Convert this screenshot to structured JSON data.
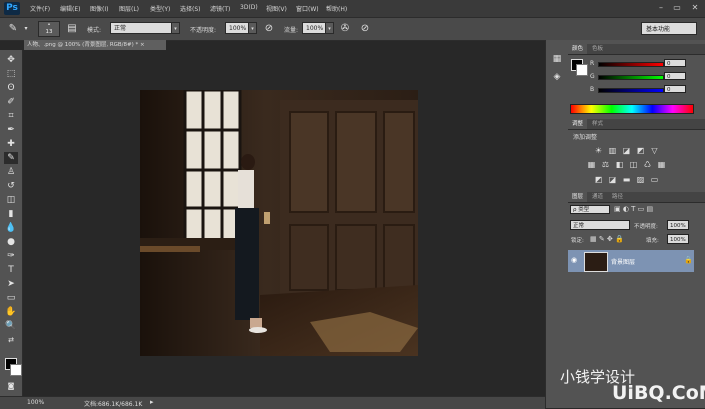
{
  "app": {
    "logo": "Ps"
  },
  "menu": [
    "文件(F)",
    "编辑(E)",
    "图像(I)",
    "图层(L)",
    "类型(Y)",
    "选择(S)",
    "滤镜(T)",
    "3D(D)",
    "视图(V)",
    "窗口(W)",
    "帮助(H)"
  ],
  "window_controls": {
    "minimize": "–",
    "restore": "▭",
    "close": "✕"
  },
  "options_bar": {
    "brush_size": "13",
    "mode_label": "模式:",
    "mode_value": "正常",
    "opacity_label": "不透明度:",
    "opacity_value": "100%",
    "flow_label": "流量:",
    "flow_value": "100%",
    "workspace": "基本功能"
  },
  "document_tab": "人物、.png @ 100% (背景图层, RGB/8#) * ×",
  "status_bar": {
    "zoom": "100%",
    "doc_size": "文档:686.1K/686.1K"
  },
  "color_panel": {
    "tabs": [
      "颜色",
      "色板"
    ],
    "channels": [
      {
        "label": "R",
        "value": "0",
        "color": "#e02020"
      },
      {
        "label": "G",
        "value": "0",
        "color": "#20c020"
      },
      {
        "label": "B",
        "value": "0",
        "color": "#2040e0"
      }
    ]
  },
  "adjust_panel": {
    "tabs": [
      "调整",
      "样式"
    ],
    "title": "添加调整",
    "row1": [
      "☀",
      "▥",
      "◪",
      "◩",
      "▽"
    ],
    "row2": [
      "▦",
      "⚖",
      "◧",
      "◫",
      "♺",
      "▦"
    ],
    "row3": [
      "◩",
      "◪",
      "▬",
      "▨",
      "▭"
    ]
  },
  "layers_panel": {
    "tabs": [
      "图层",
      "通道",
      "路径"
    ],
    "kind_label": "ρ 类型",
    "blend_mode": "正常",
    "opacity_label": "不透明度:",
    "opacity_value": "100%",
    "lock_label": "锁定:",
    "fill_label": "填充:",
    "fill_value": "100%",
    "layers": [
      {
        "name": "背景图层",
        "visible_icon": "👁"
      }
    ],
    "bottom_icons": [
      "⊖",
      "fx",
      "◐",
      "▭",
      "▤",
      "▣",
      "🗑"
    ]
  },
  "watermark": {
    "line1": "小钱学设计",
    "line2": "UiBQ.CoM"
  },
  "colors": {
    "ui_dark": "#282828",
    "ui_mid": "#535353",
    "accent_layer": "#7d93b3"
  }
}
